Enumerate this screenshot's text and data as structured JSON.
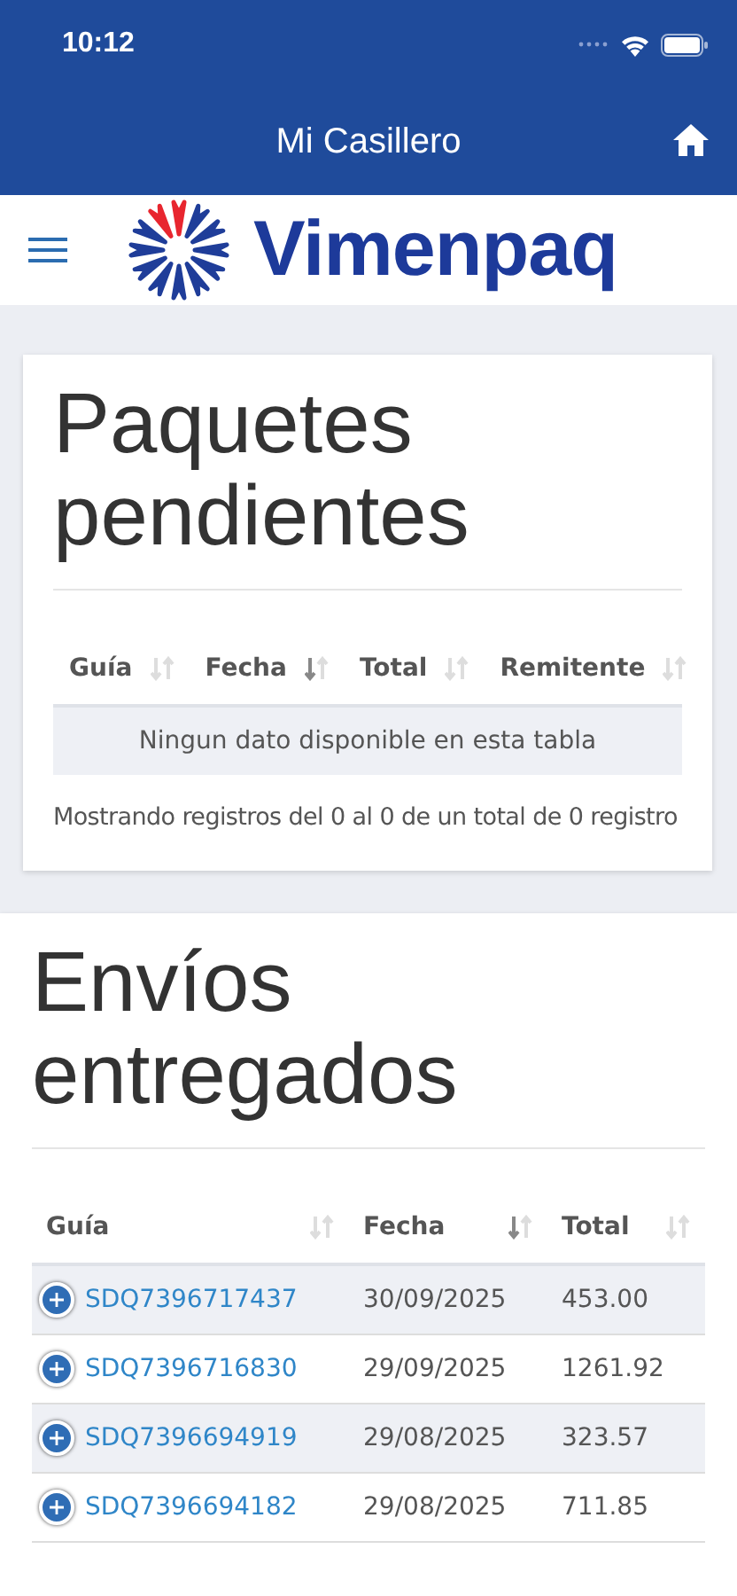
{
  "status_bar": {
    "time": "10:12"
  },
  "nav_bar": {
    "title": "Mi Casillero"
  },
  "header": {
    "brand": "Vimenpaq"
  },
  "pending": {
    "title": "Paquetes pendientes",
    "columns": [
      {
        "label": "Guía",
        "sorted": false
      },
      {
        "label": "Fecha",
        "sorted": true
      },
      {
        "label": "Total",
        "sorted": false
      },
      {
        "label": "Remitente",
        "sorted": false
      }
    ],
    "empty_message": "Ningun dato disponible en esta tabla",
    "info": "Mostrando registros del 0 al 0 de un total de 0 registro"
  },
  "delivered": {
    "title": "Envíos entregados",
    "columns": [
      {
        "label": "Guía",
        "sorted": false
      },
      {
        "label": "Fecha",
        "sorted": true
      },
      {
        "label": "Total",
        "sorted": false
      }
    ],
    "rows": [
      {
        "guide": "SDQ7396717437",
        "date": "30/09/2025",
        "total": "453.00"
      },
      {
        "guide": "SDQ7396716830",
        "date": "29/09/2025",
        "total": "1261.92"
      },
      {
        "guide": "SDQ7396694919",
        "date": "29/08/2025",
        "total": "323.57"
      },
      {
        "guide": "SDQ7396694182",
        "date": "29/08/2025",
        "total": "711.85"
      }
    ]
  }
}
